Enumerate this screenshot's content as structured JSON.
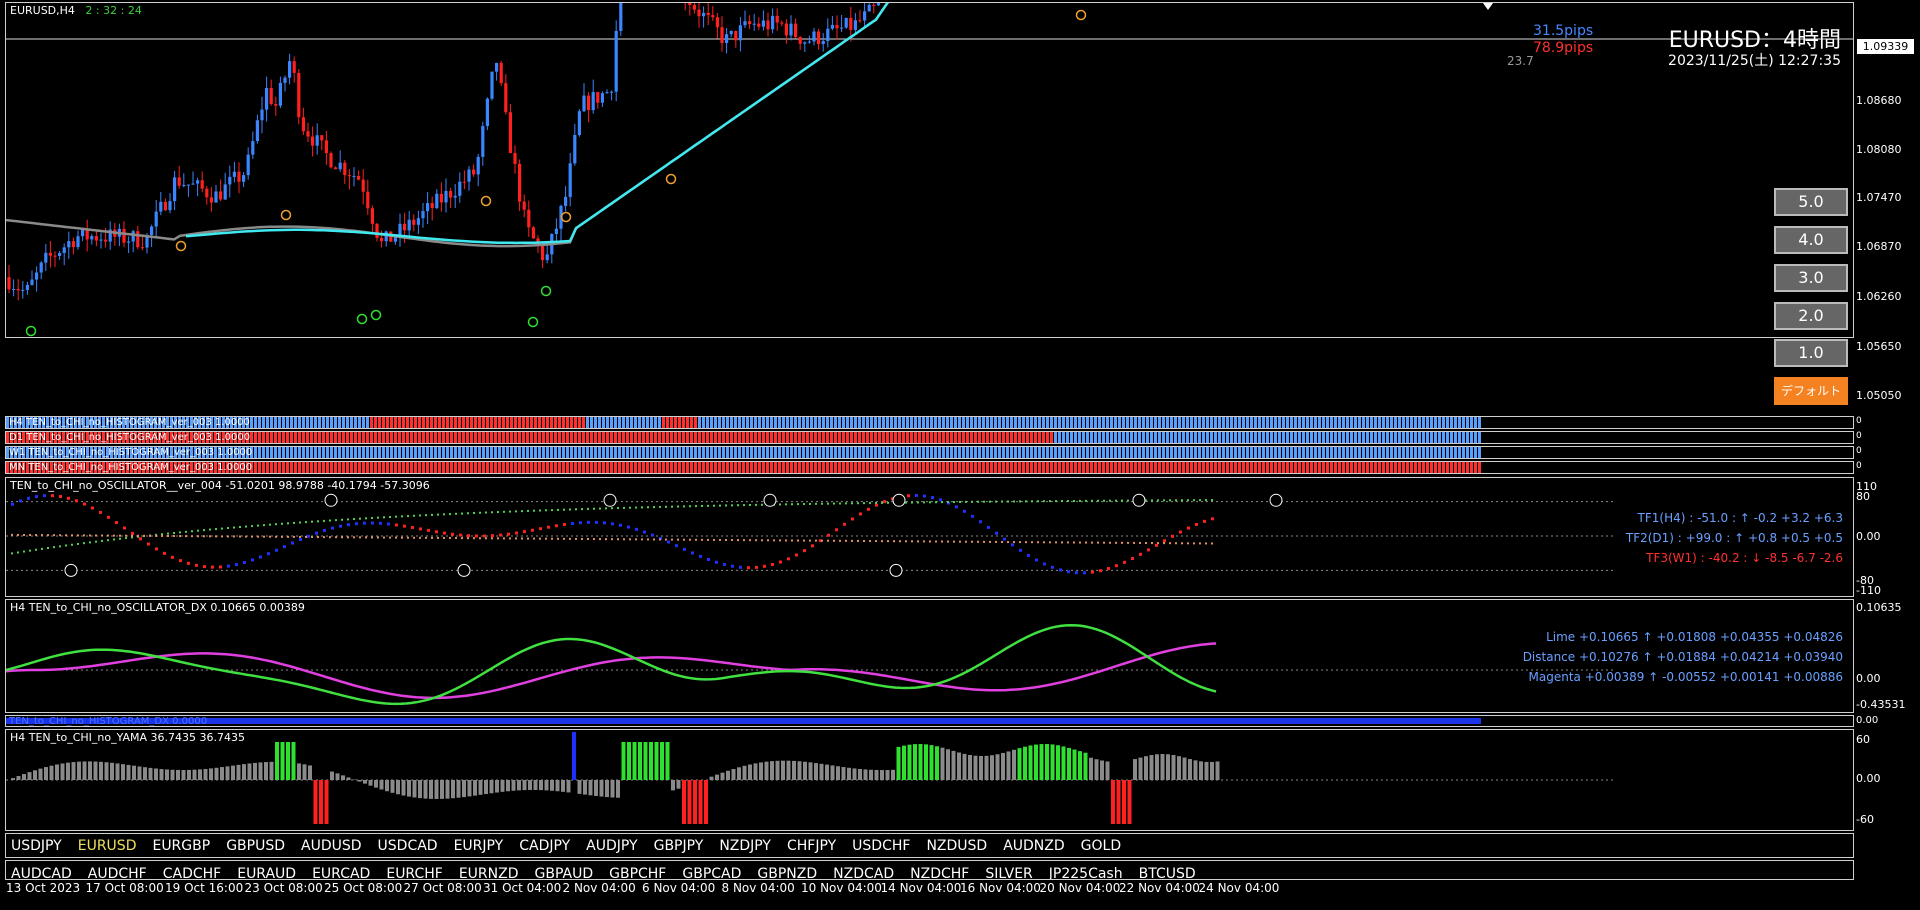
{
  "window": {
    "symbol_tf": "EURUSD,H4",
    "timer": "2 : 32 : 24"
  },
  "header": {
    "title": "EURUSD：4時間",
    "datetime": "2023/11/25(土) 12:27:35",
    "pips_up": "31.5pips",
    "pips_down": "78.9pips",
    "small_value": "23.7"
  },
  "price_axis": {
    "current": "1.09339",
    "ticks": [
      "1.08680",
      "1.08080",
      "1.07470",
      "1.06870",
      "1.06260",
      "1.05650",
      "1.05050"
    ]
  },
  "scale_buttons": [
    "5.0",
    "4.0",
    "3.0",
    "2.0",
    "1.0"
  ],
  "default_button": "デフォルト",
  "histograms": [
    {
      "label": "H4 TEN_to_CHI_no_HISTOGRAM_ver_003 1.0000",
      "axis": "0"
    },
    {
      "label": "D1 TEN_to_CHI_no_HISTOGRAM_ver_003 1.0000",
      "axis": "0"
    },
    {
      "label": "W1 TEN_to_CHI_no_HISTOGRAM_ver_003 1.0000",
      "axis": "0"
    },
    {
      "label": "MN TEN_to_CHI_no_HISTOGRAM_ver_003 1.0000",
      "axis": "0"
    }
  ],
  "oscillator": {
    "title": "TEN_to_CHI_no_OSCILLATOR__ver_004 -51.0201 98.9788 -40.1794 -57.3096",
    "ticks": [
      "110",
      "80",
      "0.00",
      "-80",
      "-110"
    ],
    "tf1": "TF1(H4) : -51.0 : ↑  -0.2 +3.2 +6.3",
    "tf2": "TF2(D1) : +99.0 : ↑  +0.8 +0.5 +0.5",
    "tf3": "TF3(W1) : -40.2 : ↓  -8.5 -6.7 -2.6",
    "colors": {
      "tf1": "#6aa0ff",
      "tf2": "#6aa0ff",
      "tf3": "#ff3030"
    }
  },
  "dx": {
    "title": "H4 TEN_to_CHI_no_OSCILLATOR_DX  0.10665 0.00389",
    "ticks": [
      "0.10635",
      "0.00",
      "-0.43531"
    ],
    "lime": "Lime +0.10665 ↑  +0.01808 +0.04355 +0.04826",
    "distance": "Distance +0.10276 ↑  +0.01884 +0.04214 +0.03940",
    "magenta": "Magenta +0.00389 ↑  -0.00552 +0.00141 +0.00886"
  },
  "hist_dx": {
    "label": "TEN_to_CHI_no_HISTOGRAM_DX 0.0000",
    "axis": "0.00"
  },
  "yama": {
    "title": "H4  TEN_to_CHI_no_YAMA  36.7435 36.7435",
    "ticks": [
      "60",
      "0.00",
      "-60"
    ]
  },
  "symbols_row1": [
    "USDJPY",
    "EURUSD",
    "EURGBP",
    "GBPUSD",
    "AUDUSD",
    "USDCAD",
    "EURJPY",
    "CADJPY",
    "AUDJPY",
    "GBPJPY",
    "NZDJPY",
    "CHFJPY",
    "USDCHF",
    "NZDUSD",
    "AUDNZD",
    "GOLD"
  ],
  "symbols_row2": [
    "AUDCAD",
    "AUDCHF",
    "CADCHF",
    "EURAUD",
    "EURCAD",
    "EURCHF",
    "EURNZD",
    "GBPAUD",
    "GBPCHF",
    "GBPCAD",
    "GBPNZD",
    "NZDCAD",
    "NZDCHF",
    "SILVER",
    "JP225Cash",
    "BTCUSD"
  ],
  "active_symbol": "EURUSD",
  "dates": [
    "13 Oct 2023",
    "17 Oct 08:00",
    "19 Oct 16:00",
    "23 Oct 08:00",
    "25 Oct 08:00",
    "27 Oct 08:00",
    "31 Oct 04:00",
    "2 Nov 04:00",
    "6 Nov 04:00",
    "8 Nov 04:00",
    "10 Nov 04:00",
    "14 Nov 04:00",
    "16 Nov 04:00",
    "20 Nov 04:00",
    "22 Nov 04:00",
    "24 Nov 04:00"
  ]
}
